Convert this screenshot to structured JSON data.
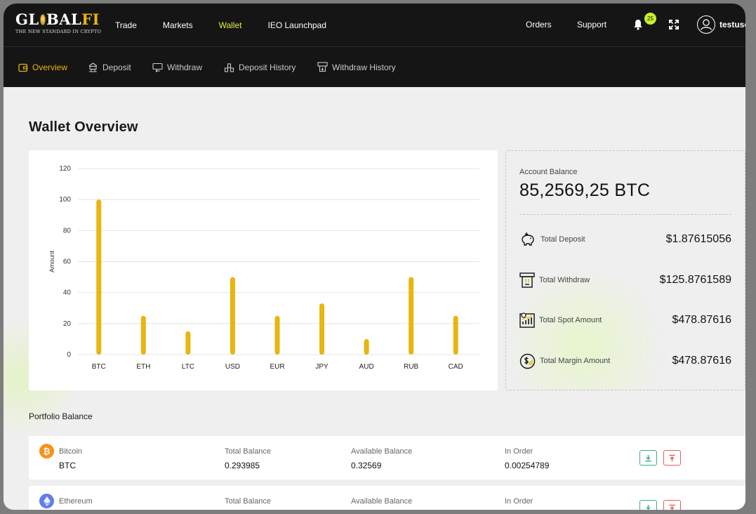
{
  "logo": {
    "text_pre": "GL",
    "text_post": "BAL",
    "text_fi": "FI",
    "tagline": "THE NEW STANDARD IN CRYPTO"
  },
  "topnav": {
    "items": [
      {
        "label": "Trade",
        "active": false
      },
      {
        "label": "Markets",
        "active": false
      },
      {
        "label": "Wallet",
        "active": true
      },
      {
        "label": "IEO Launchpad",
        "active": false
      }
    ],
    "orders": "Orders",
    "support": "Support",
    "notification_count": "25",
    "username": "testuser"
  },
  "subnav": {
    "items": [
      {
        "label": "Overview",
        "active": true,
        "icon": "wallet-icon"
      },
      {
        "label": "Deposit",
        "active": false,
        "icon": "deposit-icon"
      },
      {
        "label": "Withdraw",
        "active": false,
        "icon": "withdraw-icon"
      },
      {
        "label": "Deposit History",
        "active": false,
        "icon": "deposit-history-icon"
      },
      {
        "label": "Withdraw History",
        "active": false,
        "icon": "withdraw-history-icon"
      }
    ]
  },
  "page_title": "Wallet Overview",
  "chart_data": {
    "type": "bar",
    "categories": [
      "BTC",
      "ETH",
      "LTC",
      "USD",
      "EUR",
      "JPY",
      "AUD",
      "RUB",
      "CAD"
    ],
    "values": [
      100,
      25,
      15,
      50,
      25,
      33,
      10,
      50,
      25
    ],
    "title": "",
    "xlabel": "",
    "ylabel": "Amount",
    "ylim": [
      0,
      120
    ],
    "yticks": [
      0,
      20,
      40,
      60,
      80,
      100,
      120
    ],
    "grid": true,
    "color": "#e9b50f"
  },
  "account": {
    "label": "Account Balance",
    "value": "85,2569,25 BTC",
    "rows": [
      {
        "label": "Total Deposit",
        "value": "$1.87615056",
        "icon": "piggy-bank-icon"
      },
      {
        "label": "Total Withdraw",
        "value": "$125.8761589",
        "icon": "atm-withdraw-icon"
      },
      {
        "label": "Total Spot Amount",
        "value": "$478.87616",
        "icon": "chart-growth-icon"
      },
      {
        "label": "Total Margin Amount",
        "value": "$478.87616",
        "icon": "dollar-coin-icon"
      }
    ]
  },
  "portfolio": {
    "title": "Portfolio Balance",
    "assets": [
      {
        "name": "Bitcoin",
        "symbol": "BTC",
        "icon_char": "₿",
        "color": "#f7931a",
        "total_label": "Total Balance",
        "total": "0.293985",
        "avail_label": "Available Balance",
        "available": "0.32569",
        "order_label": "In Order",
        "in_order": "0.00254789"
      },
      {
        "name": "Ethereum",
        "symbol": "",
        "icon_char": "",
        "color": "#627eea",
        "total_label": "Total Balance",
        "total": "",
        "avail_label": "Available Balance",
        "available": "",
        "order_label": "In Order",
        "in_order": ""
      }
    ]
  }
}
